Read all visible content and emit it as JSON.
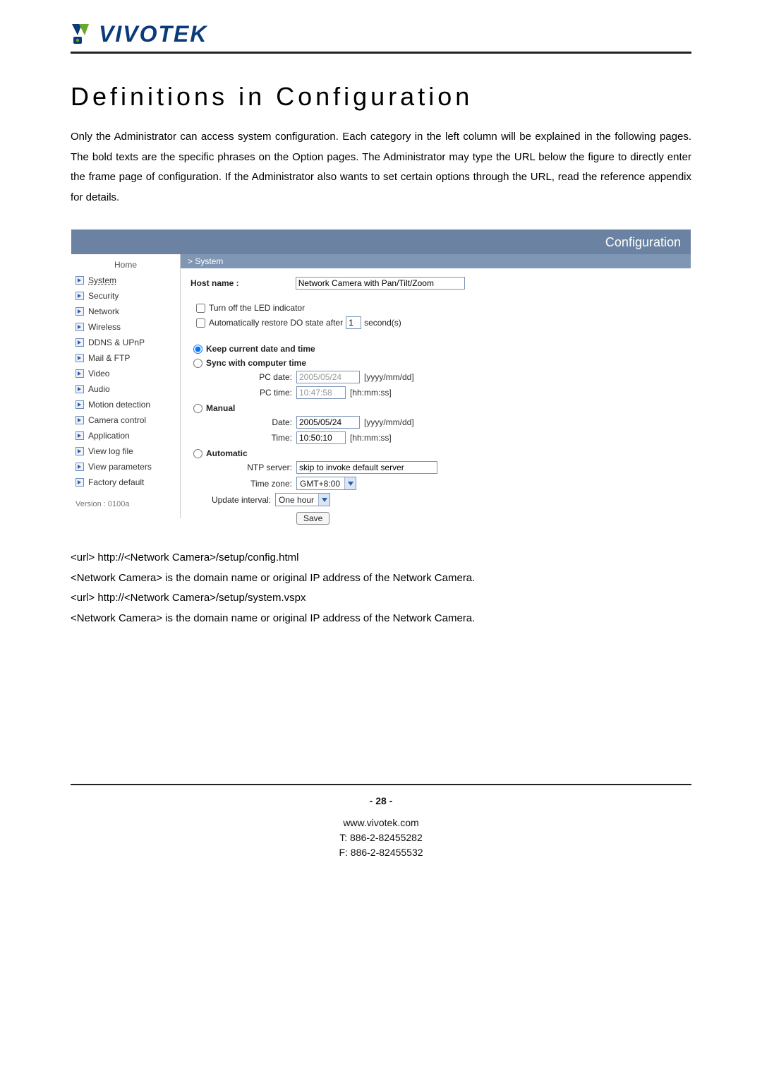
{
  "logo_text": "VIVOTEK",
  "page_title": "Definitions in Configuration",
  "lead_text": "Only the Administrator can access system configuration. Each category in the left column will be explained in the following pages. The bold texts are the specific phrases on the Option pages. The Administrator may type the URL below the figure to directly enter the frame page of configuration. If the Administrator also wants to set certain options through the URL, read the reference appendix for details.",
  "config_header": "Configuration",
  "breadcrumb": "> System",
  "sidebar": {
    "home": "Home",
    "items": [
      "System",
      "Security",
      "Network",
      "Wireless",
      "DDNS & UPnP",
      "Mail & FTP",
      "Video",
      "Audio",
      "Motion detection",
      "Camera control",
      "Application",
      "View log file",
      "View parameters",
      "Factory default"
    ],
    "version": "Version : 0100a"
  },
  "form": {
    "hostname_label": "Host name :",
    "hostname_value": "Network Camera with Pan/Tilt/Zoom",
    "led_off_label": "Turn off the LED indicator",
    "auto_restore_label": "Automatically restore DO state after",
    "auto_restore_value": "1",
    "auto_restore_suffix": "second(s)",
    "keep_label": "Keep current date and time",
    "sync_label": "Sync with computer time",
    "pc_date_label": "PC date:",
    "pc_date_value": "2005/05/24",
    "date_fmt": "[yyyy/mm/dd]",
    "pc_time_label": "PC time:",
    "pc_time_value": "10:47:58",
    "time_fmt": "[hh:mm:ss]",
    "manual_label": "Manual",
    "manual_date_label": "Date:",
    "manual_date_value": "2005/05/24",
    "manual_time_label": "Time:",
    "manual_time_value": "10:50:10",
    "auto_label": "Automatic",
    "ntp_label": "NTP server:",
    "ntp_value": "skip to invoke default server",
    "tz_label": "Time zone:",
    "tz_value": "GMT+8:00",
    "upd_label": "Update interval:",
    "upd_value": "One hour",
    "save": "Save"
  },
  "url_lines": [
    "<url> http://<Network Camera>/setup/config.html",
    "<Network Camera> is the domain name or original IP address of the Network Camera.",
    "<url> http://<Network Camera>/setup/system.vspx",
    "<Network Camera> is the domain name or original IP address of the Network Camera."
  ],
  "footer": {
    "page_num": "- 28 -",
    "site": "www.vivotek.com",
    "tel": "T: 886-2-82455282",
    "fax": "F: 886-2-82455532"
  }
}
